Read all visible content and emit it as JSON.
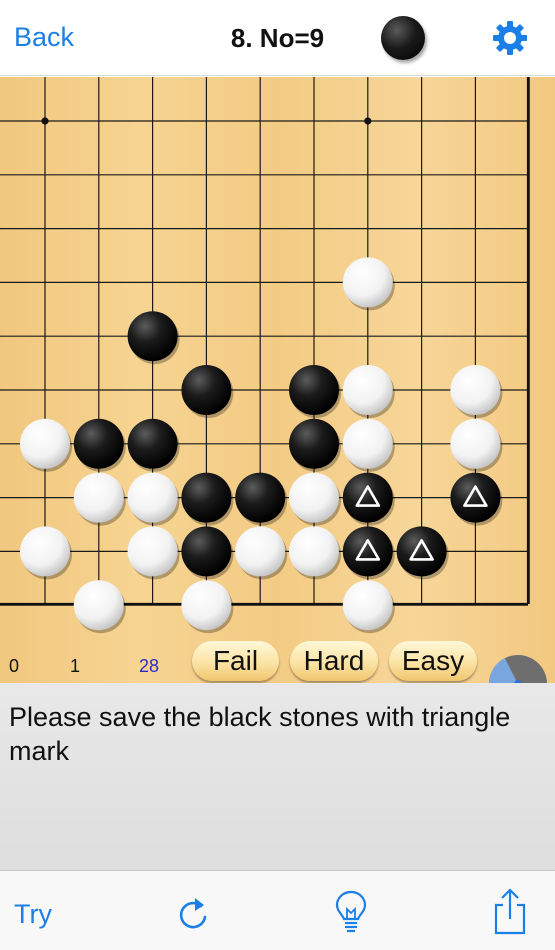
{
  "header": {
    "back_label": "Back",
    "title": "8. No=9",
    "turn_stone_icon": "black-stone-icon",
    "settings_icon": "gear-icon"
  },
  "board": {
    "columns": 10,
    "rows": 10,
    "hoshi": [
      [
        0,
        0
      ],
      [
        6,
        0
      ]
    ],
    "stones": [
      {
        "c": 6,
        "r": 3,
        "color": "white"
      },
      {
        "c": 2,
        "r": 4,
        "color": "black"
      },
      {
        "c": 3,
        "r": 5,
        "color": "black"
      },
      {
        "c": 5,
        "r": 5,
        "color": "black"
      },
      {
        "c": 6,
        "r": 5,
        "color": "white"
      },
      {
        "c": 8,
        "r": 5,
        "color": "white"
      },
      {
        "c": 0,
        "r": 6,
        "color": "white"
      },
      {
        "c": 1,
        "r": 6,
        "color": "black"
      },
      {
        "c": 2,
        "r": 6,
        "color": "black"
      },
      {
        "c": 5,
        "r": 6,
        "color": "black"
      },
      {
        "c": 6,
        "r": 6,
        "color": "white"
      },
      {
        "c": 8,
        "r": 6,
        "color": "white"
      },
      {
        "c": 1,
        "r": 7,
        "color": "white"
      },
      {
        "c": 2,
        "r": 7,
        "color": "white"
      },
      {
        "c": 3,
        "r": 7,
        "color": "black"
      },
      {
        "c": 4,
        "r": 7,
        "color": "black"
      },
      {
        "c": 5,
        "r": 7,
        "color": "white"
      },
      {
        "c": 6,
        "r": 7,
        "color": "black",
        "mark": "triangle"
      },
      {
        "c": 8,
        "r": 7,
        "color": "black",
        "mark": "triangle"
      },
      {
        "c": 0,
        "r": 8,
        "color": "white"
      },
      {
        "c": 2,
        "r": 8,
        "color": "white"
      },
      {
        "c": 3,
        "r": 8,
        "color": "black"
      },
      {
        "c": 4,
        "r": 8,
        "color": "white"
      },
      {
        "c": 5,
        "r": 8,
        "color": "white"
      },
      {
        "c": 6,
        "r": 8,
        "color": "black",
        "mark": "triangle"
      },
      {
        "c": 7,
        "r": 8,
        "color": "black",
        "mark": "triangle"
      },
      {
        "c": 1,
        "r": 9,
        "color": "white"
      },
      {
        "c": 3,
        "r": 9,
        "color": "white"
      },
      {
        "c": 6,
        "r": 9,
        "color": "white"
      }
    ]
  },
  "stats": {
    "fail_count": "0",
    "hard_count": "1",
    "easy_count": "28"
  },
  "buttons": {
    "fail": "Fail",
    "hard": "Hard",
    "easy": "Easy"
  },
  "progress": {
    "fraction": 0.35,
    "accent": "#7aa6e0",
    "base": "#6e6e6e"
  },
  "prompt": {
    "text": "Please save the black stones with triangle mark"
  },
  "toolbar": {
    "try_label": "Try",
    "redo_icon": "redo-icon",
    "hint_icon": "lightbulb-icon",
    "share_icon": "share-icon"
  },
  "colors": {
    "accent": "#1a7fe6",
    "board": "#f4cf8a"
  }
}
